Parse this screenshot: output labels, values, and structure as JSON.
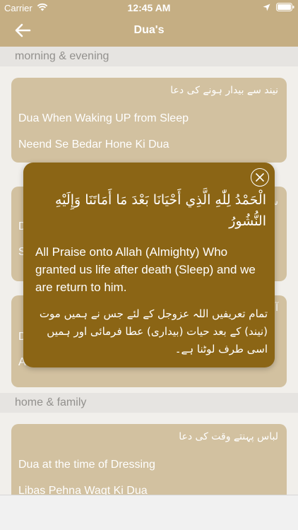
{
  "status_bar": {
    "carrier": "Carrier",
    "time": "12:45 AM"
  },
  "nav": {
    "title": "Dua's"
  },
  "sections": [
    {
      "header": "morning & evening",
      "cards": [
        {
          "urdu": "نیند سے بیدار ہونے کی دعا",
          "english": "Dua When Waking UP from Sleep",
          "roman": "Neend Se Bedar Hone Ki Dua"
        },
        {
          "urdu": "",
          "english": "",
          "roman": ""
        },
        {
          "urdu": "",
          "english": "",
          "roman": ""
        }
      ]
    },
    {
      "header": "home & family",
      "cards": [
        {
          "urdu": "لباس پہنتے وقت کی دعا",
          "english": "Dua at the time of Dressing",
          "roman": "Libas Pehna Waqt Ki Dua"
        }
      ]
    }
  ],
  "partial_chars": {
    "card2_urdu": "س",
    "card2_en": "D",
    "card2_roman": "S",
    "card3_urdu": "آ",
    "card3_en": "D",
    "card3_roman": "A"
  },
  "popup": {
    "arabic": "الْحَمْدُ لِلّٰهِ الَّذِي أَحْيَانَا بَعْدَ مَا أَمَاتَنَا وَإِلَيْهِ النُّشُورُ",
    "english": "All Praise onto Allah (Almighty) Who granted us life after death (Sleep) and we are return to him.",
    "urdu": "تمام تعریفیں اللہ عزوجل کے لئے جس نے ہمیں موت (نیند) کے بعد حیات (بیداری) عطا فرمائی اور ہمیں اسی طرف لوٹنا ہے۔"
  },
  "colors": {
    "header": "#c5ae83",
    "card": "#c8b48b",
    "popup": "#8b6515",
    "section_header_bg": "#e1dfdb"
  },
  "icons": {
    "wifi": "wifi-icon",
    "location": "location-icon",
    "battery": "battery-icon",
    "back": "back-arrow-icon",
    "close": "close-icon"
  }
}
